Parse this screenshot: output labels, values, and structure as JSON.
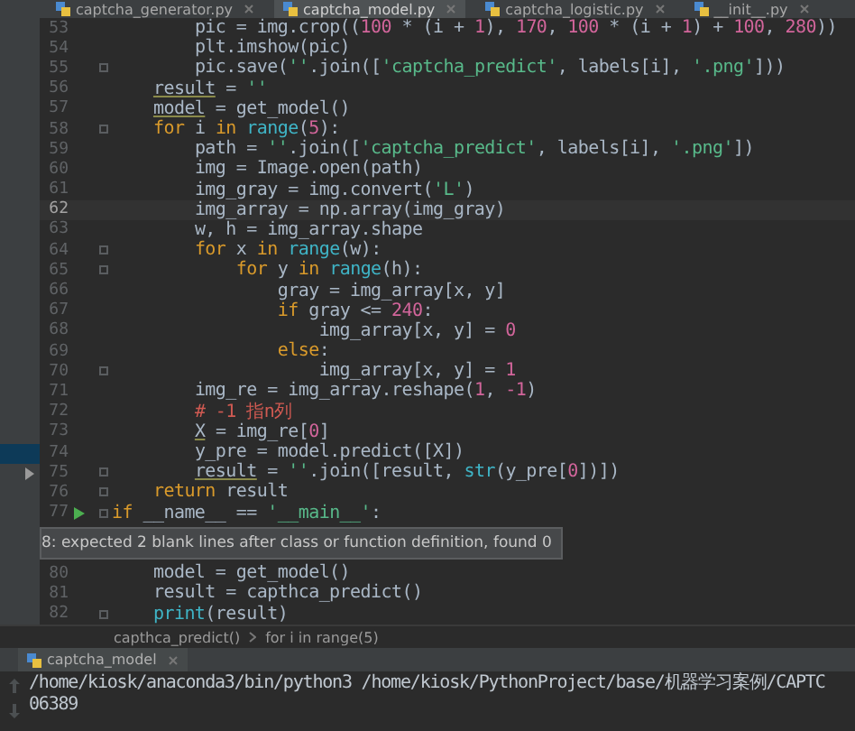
{
  "tabs": [
    {
      "label": "captcha_generator.py",
      "selected": false
    },
    {
      "label": "captcha_model.py",
      "selected": true
    },
    {
      "label": "captcha_logistic.py",
      "selected": false
    },
    {
      "label": "__init__.py",
      "selected": false
    }
  ],
  "project_panel": {
    "rows": [
      {
        "selected": true
      },
      {
        "selected": false,
        "expanded": false
      }
    ]
  },
  "editor": {
    "lines": [
      {
        "kind": "code",
        "number": "53",
        "current": false,
        "fold": false,
        "run": false,
        "tokens": [
          {
            "kind": "plain",
            "text": "        pic = img.crop(("
          },
          {
            "kind": "number",
            "text": "100"
          },
          {
            "kind": "plain",
            "text": " * (i + "
          },
          {
            "kind": "number",
            "text": "1"
          },
          {
            "kind": "plain",
            "text": "), "
          },
          {
            "kind": "number",
            "text": "170"
          },
          {
            "kind": "plain",
            "text": ", "
          },
          {
            "kind": "number",
            "text": "100"
          },
          {
            "kind": "plain",
            "text": " * (i + "
          },
          {
            "kind": "number",
            "text": "1"
          },
          {
            "kind": "plain",
            "text": ") + "
          },
          {
            "kind": "number",
            "text": "100"
          },
          {
            "kind": "plain",
            "text": ", "
          },
          {
            "kind": "number",
            "text": "280"
          },
          {
            "kind": "plain",
            "text": "))"
          }
        ]
      },
      {
        "kind": "code",
        "number": "54",
        "current": false,
        "fold": false,
        "run": false,
        "tokens": [
          {
            "kind": "plain",
            "text": "        plt.imshow(pic)"
          }
        ]
      },
      {
        "kind": "code",
        "number": "55",
        "current": false,
        "fold": true,
        "run": false,
        "tokens": [
          {
            "kind": "plain",
            "text": "        pic.save("
          },
          {
            "kind": "string",
            "text": "''"
          },
          {
            "kind": "plain",
            "text": ".join(["
          },
          {
            "kind": "string",
            "text": "'captcha_predict'"
          },
          {
            "kind": "plain",
            "text": ", labels[i], "
          },
          {
            "kind": "string",
            "text": "'.png'"
          },
          {
            "kind": "plain",
            "text": "]))"
          }
        ]
      },
      {
        "kind": "code",
        "number": "56",
        "current": false,
        "fold": false,
        "run": false,
        "tokens": [
          {
            "kind": "warning",
            "text": "    result"
          },
          {
            "kind": "plain",
            "text": " = "
          },
          {
            "kind": "string",
            "text": "''"
          }
        ]
      },
      {
        "kind": "code",
        "number": "57",
        "current": false,
        "fold": false,
        "run": false,
        "tokens": [
          {
            "kind": "warning",
            "text": "    model"
          },
          {
            "kind": "plain",
            "text": " = get_model()"
          }
        ]
      },
      {
        "kind": "code",
        "number": "58",
        "current": false,
        "fold": true,
        "run": false,
        "tokens": [
          {
            "kind": "keyword",
            "text": "    for"
          },
          {
            "kind": "plain",
            "text": " i "
          },
          {
            "kind": "keyword",
            "text": "in"
          },
          {
            "kind": "builtin",
            "text": " range"
          },
          {
            "kind": "plain",
            "text": "("
          },
          {
            "kind": "number",
            "text": "5"
          },
          {
            "kind": "plain",
            "text": "):"
          }
        ]
      },
      {
        "kind": "code",
        "number": "59",
        "current": false,
        "fold": false,
        "run": false,
        "tokens": [
          {
            "kind": "plain",
            "text": "        path = "
          },
          {
            "kind": "string",
            "text": "''"
          },
          {
            "kind": "plain",
            "text": ".join(["
          },
          {
            "kind": "string",
            "text": "'captcha_predict'"
          },
          {
            "kind": "plain",
            "text": ", labels[i], "
          },
          {
            "kind": "string",
            "text": "'.png'"
          },
          {
            "kind": "plain",
            "text": "])"
          }
        ]
      },
      {
        "kind": "code",
        "number": "60",
        "current": false,
        "fold": false,
        "run": false,
        "tokens": [
          {
            "kind": "plain",
            "text": "        img = Image.open(path)"
          }
        ]
      },
      {
        "kind": "code",
        "number": "61",
        "current": false,
        "fold": false,
        "run": false,
        "tokens": [
          {
            "kind": "plain",
            "text": "        img_gray = img.convert("
          },
          {
            "kind": "string",
            "text": "'L'"
          },
          {
            "kind": "plain",
            "text": ")"
          }
        ]
      },
      {
        "kind": "code",
        "number": "62",
        "current": true,
        "fold": false,
        "run": false,
        "tokens": [
          {
            "kind": "plain",
            "text": "        img_array = np.array(img_gray)"
          }
        ]
      },
      {
        "kind": "code",
        "number": "63",
        "current": false,
        "fold": false,
        "run": false,
        "tokens": [
          {
            "kind": "plain",
            "text": "        w, h = img_array.shape"
          }
        ]
      },
      {
        "kind": "code",
        "number": "64",
        "current": false,
        "fold": true,
        "run": false,
        "tokens": [
          {
            "kind": "keyword",
            "text": "        for"
          },
          {
            "kind": "plain",
            "text": " x "
          },
          {
            "kind": "keyword",
            "text": "in"
          },
          {
            "kind": "builtin",
            "text": " range"
          },
          {
            "kind": "plain",
            "text": "(w):"
          }
        ]
      },
      {
        "kind": "code",
        "number": "65",
        "current": false,
        "fold": true,
        "run": false,
        "tokens": [
          {
            "kind": "keyword",
            "text": "            for"
          },
          {
            "kind": "plain",
            "text": " y "
          },
          {
            "kind": "keyword",
            "text": "in"
          },
          {
            "kind": "builtin",
            "text": " range"
          },
          {
            "kind": "plain",
            "text": "(h):"
          }
        ]
      },
      {
        "kind": "code",
        "number": "66",
        "current": false,
        "fold": false,
        "run": false,
        "tokens": [
          {
            "kind": "plain",
            "text": "                gray = img_array[x, y]"
          }
        ]
      },
      {
        "kind": "code",
        "number": "67",
        "current": false,
        "fold": false,
        "run": false,
        "tokens": [
          {
            "kind": "keyword",
            "text": "                if"
          },
          {
            "kind": "plain",
            "text": " gray <= "
          },
          {
            "kind": "number",
            "text": "240"
          },
          {
            "kind": "plain",
            "text": ":"
          }
        ]
      },
      {
        "kind": "code",
        "number": "68",
        "current": false,
        "fold": false,
        "run": false,
        "tokens": [
          {
            "kind": "plain",
            "text": "                    img_array[x, y] = "
          },
          {
            "kind": "number",
            "text": "0"
          }
        ]
      },
      {
        "kind": "code",
        "number": "69",
        "current": false,
        "fold": false,
        "run": false,
        "tokens": [
          {
            "kind": "keyword",
            "text": "                else"
          },
          {
            "kind": "plain",
            "text": ":"
          }
        ]
      },
      {
        "kind": "code",
        "number": "70",
        "current": false,
        "fold": true,
        "run": false,
        "tokens": [
          {
            "kind": "plain",
            "text": "                    img_array[x, y] = "
          },
          {
            "kind": "number",
            "text": "1"
          }
        ]
      },
      {
        "kind": "code",
        "number": "71",
        "current": false,
        "fold": false,
        "run": false,
        "tokens": [
          {
            "kind": "plain",
            "text": "        img_re = img_array.reshape("
          },
          {
            "kind": "number",
            "text": "1"
          },
          {
            "kind": "plain",
            "text": ", "
          },
          {
            "kind": "number",
            "text": "-1"
          },
          {
            "kind": "plain",
            "text": ")"
          }
        ]
      },
      {
        "kind": "code",
        "number": "72",
        "current": false,
        "fold": false,
        "run": false,
        "tokens": [
          {
            "kind": "comment",
            "text": "        # -1 指n列"
          }
        ]
      },
      {
        "kind": "code",
        "number": "73",
        "current": false,
        "fold": false,
        "run": false,
        "tokens": [
          {
            "kind": "warning",
            "text": "        X"
          },
          {
            "kind": "plain",
            "text": " = img_re["
          },
          {
            "kind": "number",
            "text": "0"
          },
          {
            "kind": "plain",
            "text": "]"
          }
        ]
      },
      {
        "kind": "code",
        "number": "74",
        "current": false,
        "fold": false,
        "run": false,
        "tokens": [
          {
            "kind": "plain",
            "text": "        y_pre = model.predict([X])"
          }
        ]
      },
      {
        "kind": "code",
        "number": "75",
        "current": false,
        "fold": true,
        "run": false,
        "tokens": [
          {
            "kind": "warning",
            "text": "        result"
          },
          {
            "kind": "plain",
            "text": " = "
          },
          {
            "kind": "string",
            "text": "''"
          },
          {
            "kind": "plain",
            "text": ".join([result, "
          },
          {
            "kind": "builtin",
            "text": "str"
          },
          {
            "kind": "plain",
            "text": "(y_pre["
          },
          {
            "kind": "number",
            "text": "0"
          },
          {
            "kind": "plain",
            "text": "])])"
          }
        ]
      },
      {
        "kind": "code",
        "number": "76",
        "current": false,
        "fold": true,
        "run": false,
        "tokens": [
          {
            "kind": "keyword",
            "text": "    return"
          },
          {
            "kind": "plain",
            "text": " result"
          }
        ]
      },
      {
        "kind": "code",
        "number": "77",
        "current": false,
        "fold": true,
        "run": true,
        "tokens": [
          {
            "kind": "keyword",
            "text": "if"
          },
          {
            "kind": "plain",
            "text": " __name__ == "
          },
          {
            "kind": "string",
            "text": "'__main__'"
          },
          {
            "kind": "plain",
            "text": ":"
          }
        ]
      },
      {
        "kind": "tooltip",
        "text": "8: expected 2 blank lines after class or function definition, found 0"
      },
      {
        "kind": "code",
        "number": "80",
        "current": false,
        "fold": false,
        "run": false,
        "tokens": [
          {
            "kind": "plain",
            "text": "    model = get_model()"
          }
        ]
      },
      {
        "kind": "code",
        "number": "81",
        "current": false,
        "fold": false,
        "run": false,
        "tokens": [
          {
            "kind": "plain",
            "text": "    result = capthca_predict()"
          }
        ]
      },
      {
        "kind": "code",
        "number": "82",
        "current": false,
        "fold": true,
        "run": false,
        "tokens": [
          {
            "kind": "builtin",
            "text": "    print"
          },
          {
            "kind": "plain",
            "text": "(result)"
          }
        ]
      }
    ]
  },
  "breadcrumbs": [
    "capthca_predict()",
    "for i in range(5)"
  ],
  "run_panel": {
    "tab": "captcha_model",
    "output": [
      "/home/kiosk/anaconda3/bin/python3 /home/kiosk/PythonProject/base/机器学习案例/CAPTC",
      "06389"
    ]
  }
}
